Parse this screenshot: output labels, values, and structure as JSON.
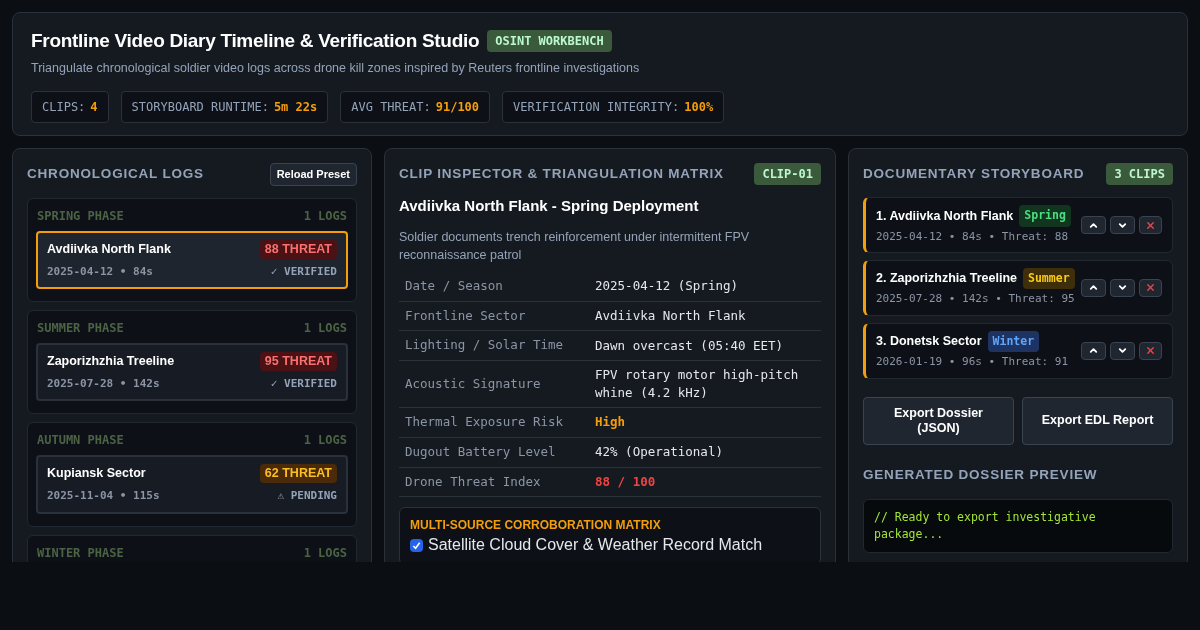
{
  "header": {
    "title": "Frontline Video Diary Timeline & Verification Studio",
    "badge": "OSINT WORKBENCH",
    "subtitle": "Triangulate chronological soldier video logs across drone kill zones inspired by Reuters frontline investigations",
    "stats": [
      {
        "label": "CLIPS:",
        "value": "4"
      },
      {
        "label": "STORYBOARD RUNTIME:",
        "value": "5m 22s"
      },
      {
        "label": "AVG THREAT:",
        "value": "91/100"
      },
      {
        "label": "VERIFICATION INTEGRITY:",
        "value": "100%"
      }
    ]
  },
  "logs": {
    "title": "CHRONOLOGICAL LOGS",
    "button": "Reload Preset",
    "phases": [
      {
        "name": "SPRING PHASE",
        "count": "1 LOGS",
        "clips": [
          {
            "title": "Avdiivka North Flank",
            "threat": "88 THREAT",
            "kind": "critical",
            "meta": "2025-04-12 • 84s",
            "status": "✓ VERIFIED",
            "selected": true
          }
        ]
      },
      {
        "name": "SUMMER PHASE",
        "count": "1 LOGS",
        "clips": [
          {
            "title": "Zaporizhzhia Treeline",
            "threat": "95 THREAT",
            "kind": "critical",
            "meta": "2025-07-28 • 142s",
            "status": "✓ VERIFIED",
            "selected": false
          }
        ]
      },
      {
        "name": "AUTUMN PHASE",
        "count": "1 LOGS",
        "clips": [
          {
            "title": "Kupiansk Sector",
            "threat": "62 THREAT",
            "kind": "elevated",
            "meta": "2025-11-04 • 115s",
            "status": "⚠ PENDING",
            "selected": false
          }
        ]
      },
      {
        "name": "WINTER PHASE",
        "count": "1 LOGS"
      }
    ]
  },
  "inspector": {
    "title": "CLIP INSPECTOR & TRIANGULATION MATRIX",
    "badge": "CLIP-01",
    "clip_title": "Avdiivka North Flank - Spring Deployment",
    "description": "Soldier documents trench reinforcement under intermittent FPV reconnaissance patrol",
    "rows": [
      {
        "label": "Date / Season",
        "value": "2025-04-12 (Spring)",
        "kind": "plain"
      },
      {
        "label": "Frontline Sector",
        "value": "Avdiivka North Flank",
        "kind": "plain"
      },
      {
        "label": "Lighting / Solar Time",
        "value": "Dawn overcast (05:40 EET)",
        "kind": "plain"
      },
      {
        "label": "Acoustic Signature",
        "value": "FPV rotary motor high-pitch whine (4.2 kHz)",
        "kind": "plain"
      },
      {
        "label": "Thermal Exposure Risk",
        "value": "High",
        "kind": "warning"
      },
      {
        "label": "Dugout Battery Level",
        "value": "42% (Operational)",
        "kind": "plain"
      },
      {
        "label": "Drone Threat Index",
        "value": "88 / 100",
        "kind": "danger"
      }
    ],
    "matrix": {
      "title": "MULTI-SOURCE CORROBORATION MATRIX",
      "items": [
        {
          "label": "Satellite Cloud Cover & Weather Record Match",
          "checked": true
        }
      ]
    }
  },
  "storyboard": {
    "title": "DOCUMENTARY STORYBOARD",
    "badge": "3 CLIPS",
    "items": [
      {
        "title": "1. Avdiivka North Flank",
        "season": "Spring",
        "kind": "spring",
        "meta": "2025-04-12 • 84s • Threat: 88"
      },
      {
        "title": "2. Zaporizhzhia Treeline",
        "season": "Summer",
        "kind": "summer",
        "meta": "2025-07-28 • 142s • Threat: 95"
      },
      {
        "title": "3. Donetsk Sector",
        "season": "Winter",
        "kind": "winter",
        "meta": "2026-01-19 • 96s • Threat: 91"
      }
    ],
    "buttons": [
      "Export Dossier (JSON)",
      "Export EDL Report"
    ],
    "preview_title": "GENERATED DOSSIER PREVIEW",
    "preview": "// Ready to export investigative package..."
  }
}
